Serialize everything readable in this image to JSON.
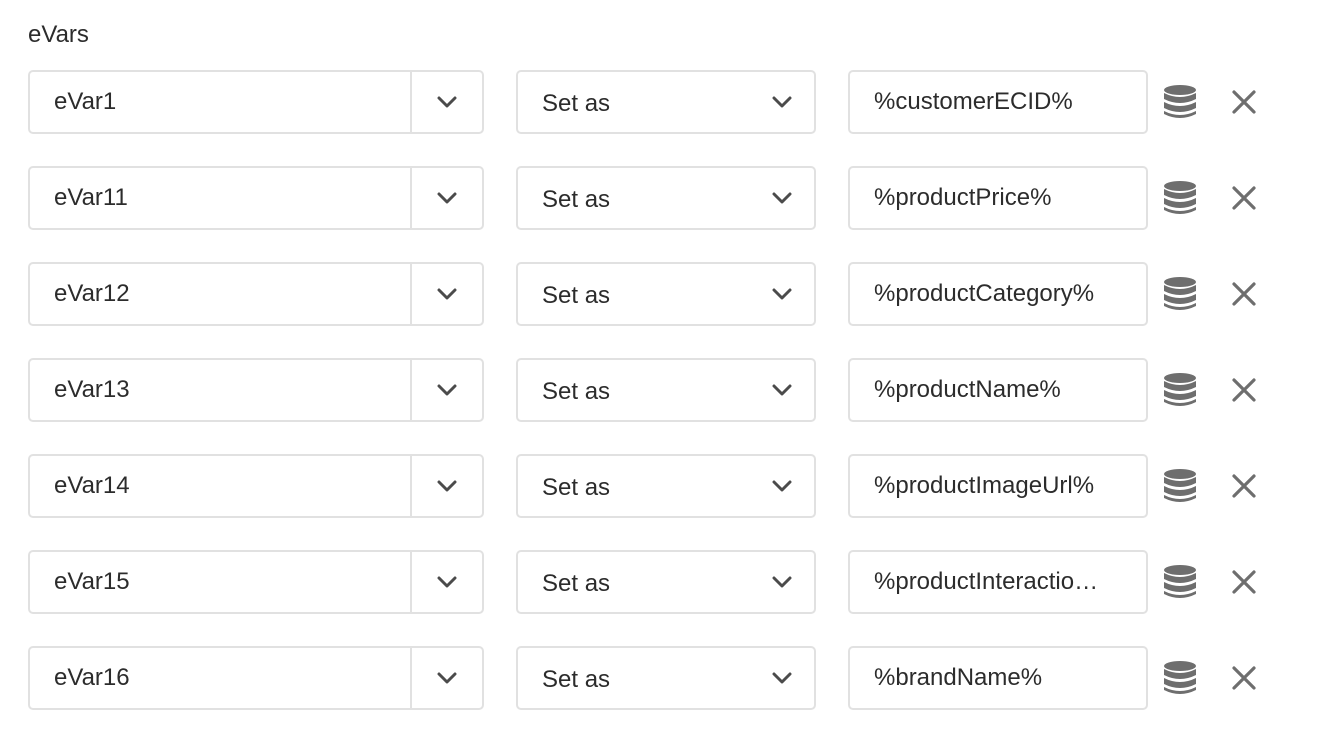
{
  "section": {
    "title": "eVars"
  },
  "rows": [
    {
      "variable": "eVar1",
      "action": "Set as",
      "value": "%customerECID%"
    },
    {
      "variable": "eVar11",
      "action": "Set as",
      "value": "%productPrice%"
    },
    {
      "variable": "eVar12",
      "action": "Set as",
      "value": "%productCategory%"
    },
    {
      "variable": "eVar13",
      "action": "Set as",
      "value": "%productName%"
    },
    {
      "variable": "eVar14",
      "action": "Set as",
      "value": "%productImageUrl%"
    },
    {
      "variable": "eVar15",
      "action": "Set as",
      "value": "%productInteractio…"
    },
    {
      "variable": "eVar16",
      "action": "Set as",
      "value": "%brandName%"
    }
  ],
  "icons": {
    "combo_toggle": "chevron-down-icon",
    "select_toggle": "chevron-down-icon",
    "data_element": "database-icon",
    "remove": "close-icon"
  },
  "colors": {
    "border": "#e1e1e1",
    "text": "#2c2c2c",
    "icon": "#6e6e6e"
  }
}
